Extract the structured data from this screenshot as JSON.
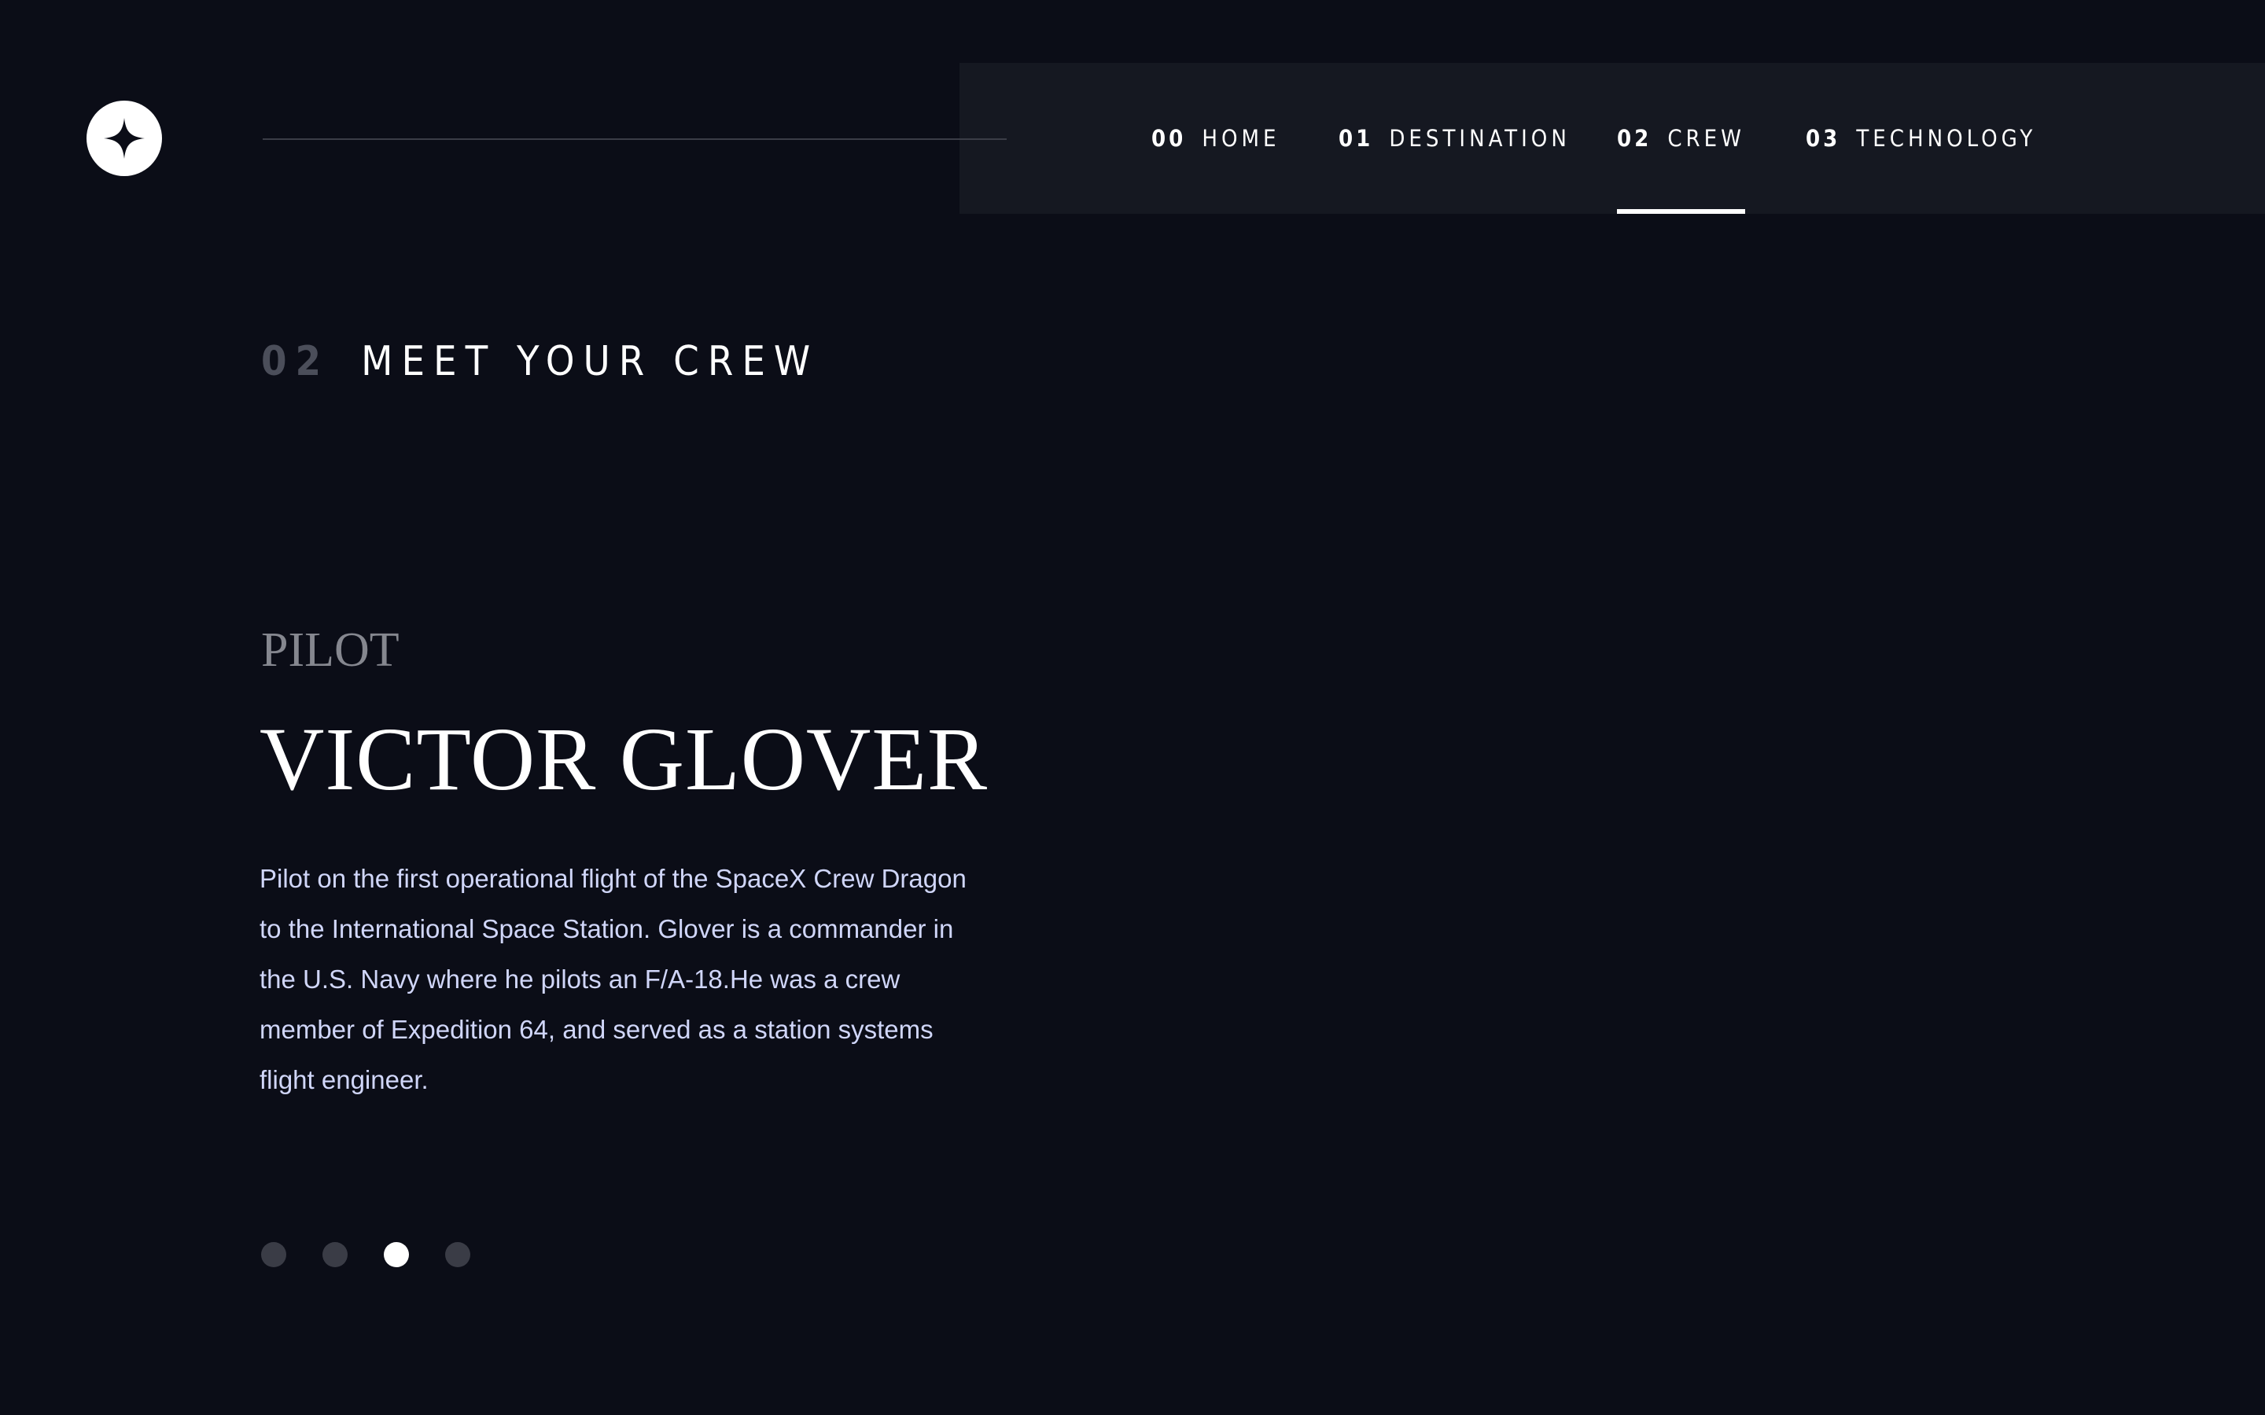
{
  "header": {
    "logo_icon": "star-logo-icon",
    "nav": [
      {
        "num": "00",
        "label": "HOME",
        "active": false
      },
      {
        "num": "01",
        "label": "DESTINATION",
        "active": false
      },
      {
        "num": "02",
        "label": "CREW",
        "active": true
      },
      {
        "num": "03",
        "label": "TECHNOLOGY",
        "active": false
      }
    ]
  },
  "section": {
    "num": "02",
    "title": "MEET YOUR CREW"
  },
  "crew": {
    "role": "PILOT",
    "name": "VICTOR GLOVER",
    "bio": "Pilot on the first operational flight of the SpaceX Crew Dragon to the International Space Station. Glover is a commander in the U.S. Navy where he pilots an F/A-18.He was a crew member of Expedition 64, and served as a station systems flight engineer.",
    "slides_total": 4,
    "active_slide": 3
  },
  "colors": {
    "background": "#0b0d17",
    "nav_background": "#151821",
    "accent_text": "#d0d6f9",
    "muted_number": "#4b4e5a",
    "inactive_dot": "#3a3c46"
  }
}
